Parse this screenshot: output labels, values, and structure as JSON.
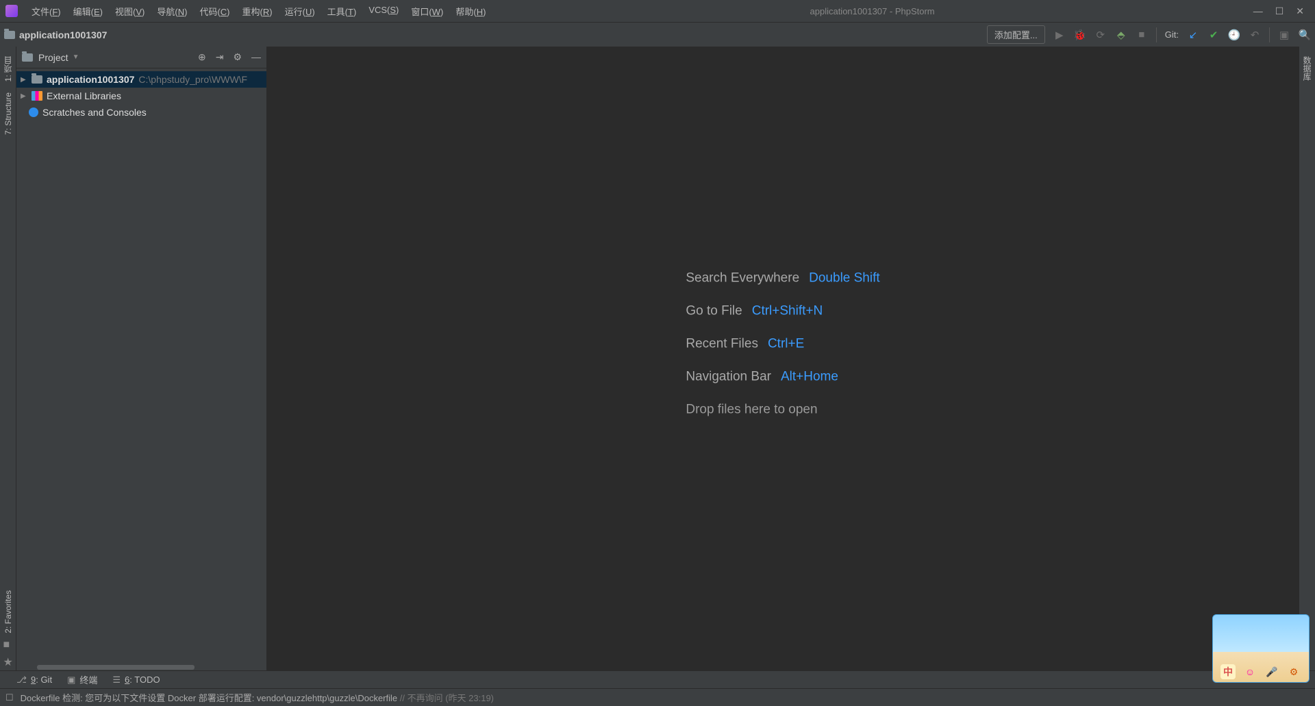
{
  "titlebar": {
    "menus": [
      {
        "pre": "文件(",
        "u": "F",
        "post": ")"
      },
      {
        "pre": "编辑(",
        "u": "E",
        "post": ")"
      },
      {
        "pre": "视图(",
        "u": "V",
        "post": ")"
      },
      {
        "pre": "导航(",
        "u": "N",
        "post": ")"
      },
      {
        "pre": "代码(",
        "u": "C",
        "post": ")"
      },
      {
        "pre": "重构(",
        "u": "R",
        "post": ")"
      },
      {
        "pre": "运行(",
        "u": "U",
        "post": ")"
      },
      {
        "pre": "工具(",
        "u": "T",
        "post": ")"
      },
      {
        "pre": "VCS(",
        "u": "S",
        "post": ")"
      },
      {
        "pre": "窗口(",
        "u": "W",
        "post": ")"
      },
      {
        "pre": "帮助(",
        "u": "H",
        "post": ")"
      }
    ],
    "window_title": "application1001307 - PhpStorm"
  },
  "navbar": {
    "project_name": "application1001307",
    "add_config": "添加配置...",
    "git_label": "Git:"
  },
  "left_strip": {
    "project_tab": "1: 项目",
    "structure_tab": "7: Structure",
    "favorites_tab": "2: Favorites"
  },
  "right_strip": {
    "db_tab": "数据库"
  },
  "project_panel": {
    "title": "Project",
    "tree": {
      "root_name": "application1001307",
      "root_path": "C:\\phpstudy_pro\\WWW\\F",
      "external": "External Libraries",
      "scratches": "Scratches and Consoles"
    }
  },
  "editor_tips": [
    {
      "label": "Search Everywhere",
      "key": "Double Shift"
    },
    {
      "label": "Go to File",
      "key": "Ctrl+Shift+N"
    },
    {
      "label": "Recent Files",
      "key": "Ctrl+E"
    },
    {
      "label": "Navigation Bar",
      "key": "Alt+Home"
    }
  ],
  "editor_drop": "Drop files here to open",
  "bottom_tabs": {
    "git": {
      "u": "9",
      "post": ": Git"
    },
    "terminal": "终端",
    "todo": {
      "u": "6",
      "post": ": TODO"
    }
  },
  "statusbar": {
    "msg_pre": "Dockerfile 检测: 您可为以下文件设置 Docker 部署运行配置: vendor\\guzzlehttp\\guzzle\\Dockerfile",
    "msg_post": " // 不再询问 (昨天 23:19)"
  },
  "tray": {
    "ime": "中"
  }
}
